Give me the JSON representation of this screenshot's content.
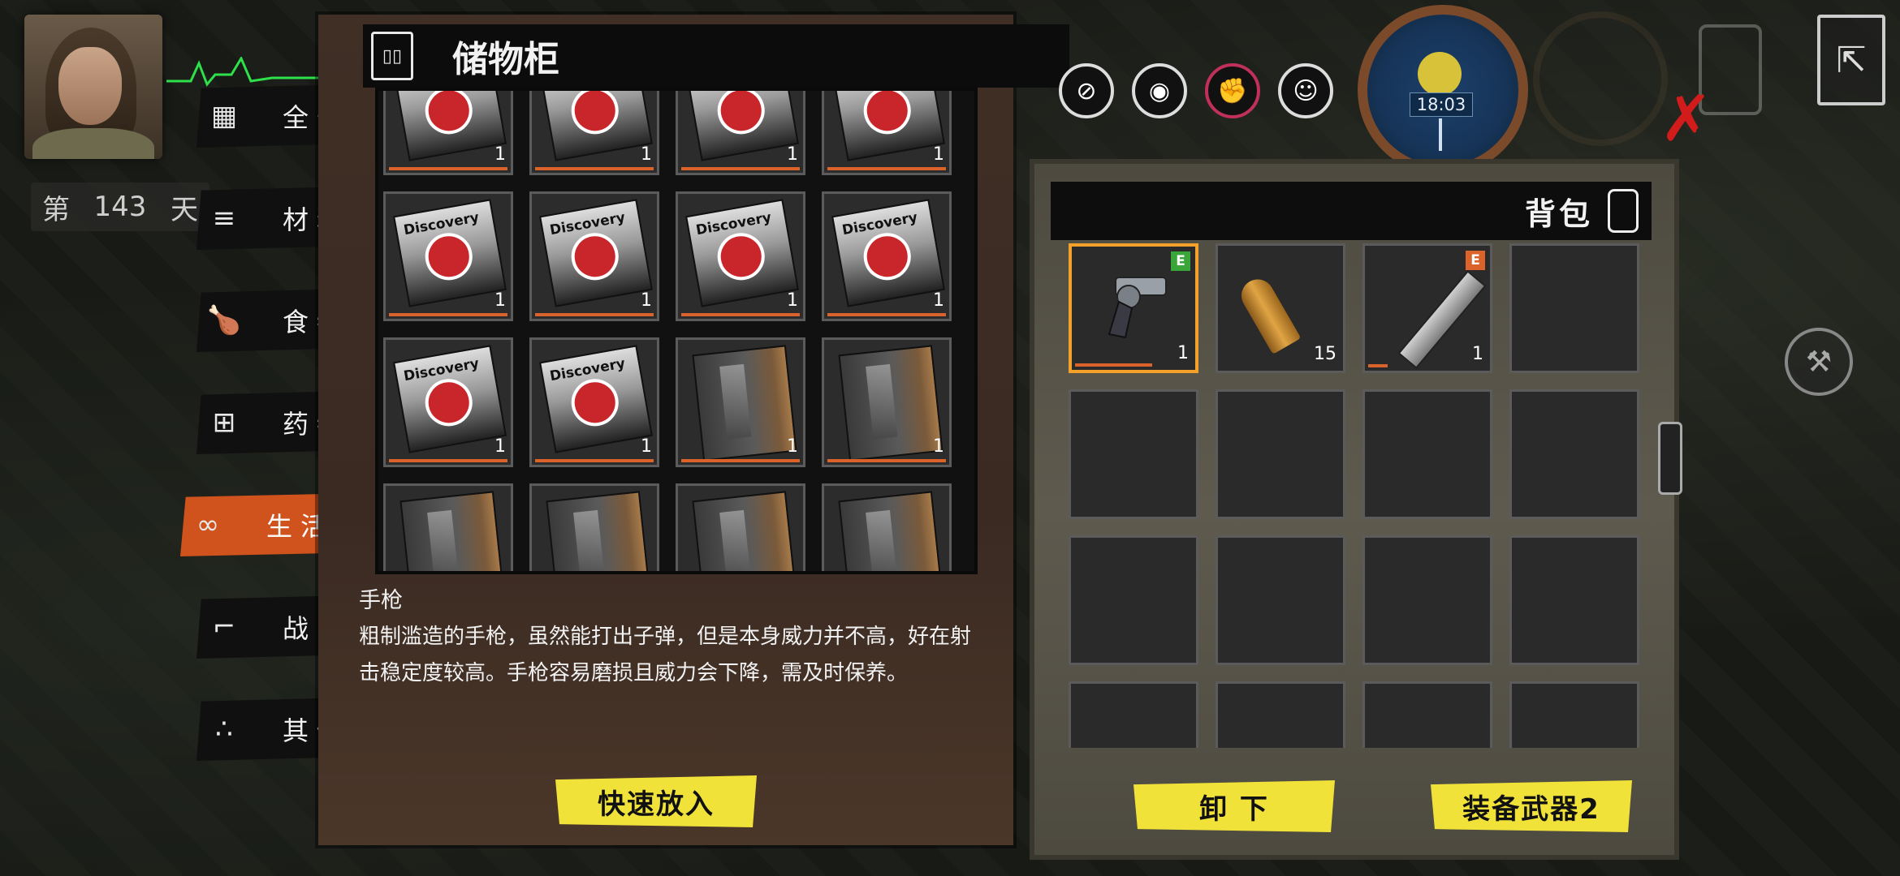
{
  "player": {
    "day_label_prefix": "第",
    "day": "143",
    "day_label_suffix": "天"
  },
  "categories": [
    {
      "label": "全部",
      "icon": "grid-icon"
    },
    {
      "label": "材料",
      "icon": "wood-planks-icon"
    },
    {
      "label": "食物",
      "icon": "chicken-icon"
    },
    {
      "label": "药物",
      "icon": "medicine-bottle-icon"
    },
    {
      "label": "生活",
      "icon": "rope-icon",
      "active": true
    },
    {
      "label": "战斗",
      "icon": "pistol-icon"
    },
    {
      "label": "其他",
      "icon": "dots-icon"
    }
  ],
  "storage": {
    "title": "储物柜",
    "items": [
      {
        "type": "magazine",
        "count": "1"
      },
      {
        "type": "magazine",
        "count": "1"
      },
      {
        "type": "magazine",
        "count": "1"
      },
      {
        "type": "magazine",
        "count": "1"
      },
      {
        "type": "magazine",
        "count": "1"
      },
      {
        "type": "magazine",
        "count": "1"
      },
      {
        "type": "magazine",
        "count": "1"
      },
      {
        "type": "magazine",
        "count": "1"
      },
      {
        "type": "magazine",
        "count": "1"
      },
      {
        "type": "magazine",
        "count": "1"
      },
      {
        "type": "book",
        "count": "1"
      },
      {
        "type": "book",
        "count": "1"
      },
      {
        "type": "book",
        "count": ""
      },
      {
        "type": "book",
        "count": ""
      },
      {
        "type": "book",
        "count": ""
      },
      {
        "type": "book",
        "count": ""
      }
    ],
    "magazine_text": "Discovery",
    "quick_put_label": "快速放入"
  },
  "description": {
    "name": "手枪",
    "text": "粗制滥造的手枪，虽然能打出子弹，但是本身威力并不高，好在射击稳定度较高。手枪容易磨损且威力会下降，需及时保养。"
  },
  "status_icons": [
    "bandage-icon",
    "eye-icon",
    "fist-icon",
    "smile-icon"
  ],
  "clock": {
    "time": "18:03"
  },
  "backpack": {
    "title": "背包",
    "items": [
      {
        "name": "pistol",
        "count": "1",
        "badge": "E",
        "badge_color": "#3aa63a",
        "durability": 0.8,
        "selected": true
      },
      {
        "name": "bullet",
        "count": "15"
      },
      {
        "name": "machete",
        "count": "1",
        "badge": "E",
        "badge_color": "#d9632a",
        "durability": 0.2
      }
    ],
    "slots_total": 16,
    "unload_label": "卸 下",
    "equip_label": "装备武器2"
  },
  "colors": {
    "accent": "#d0521d",
    "button_yellow": "#f1e23a",
    "selected_border": "#f3a12a",
    "close_red": "#d21b1b"
  }
}
